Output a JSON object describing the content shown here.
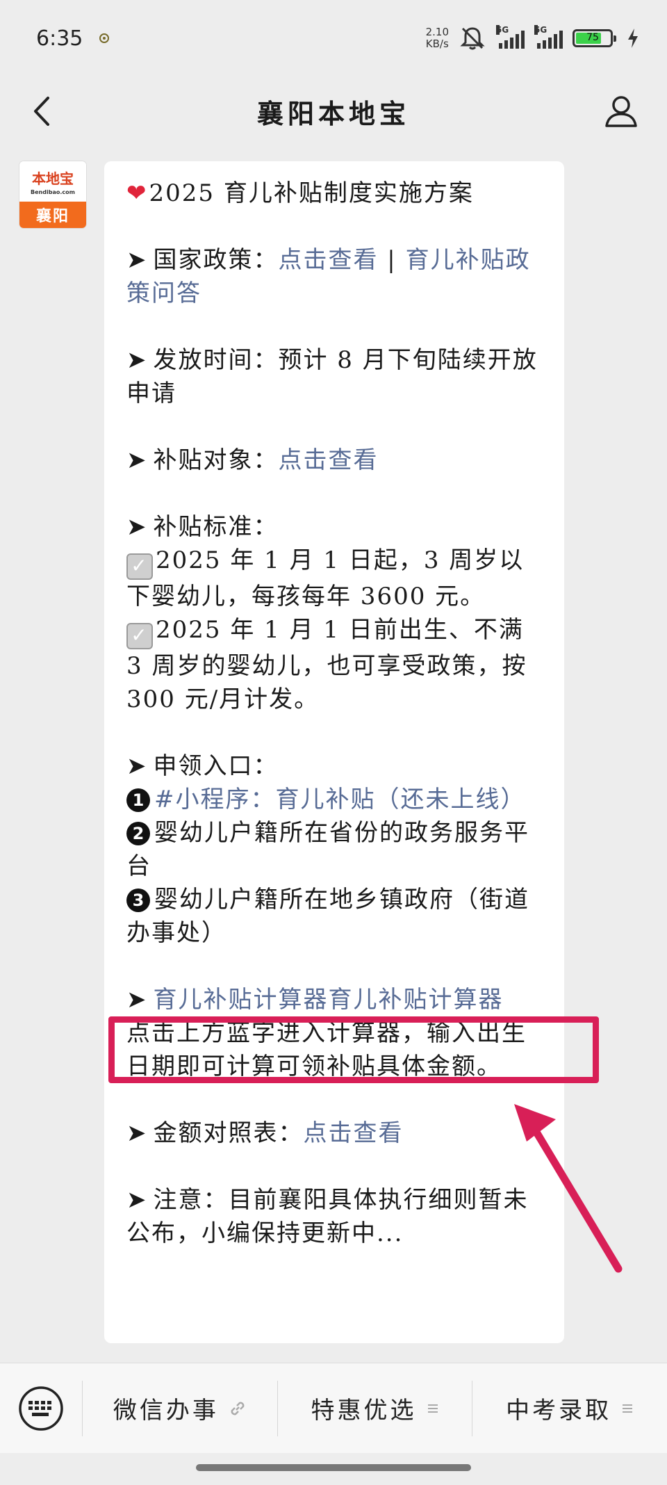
{
  "status_bar": {
    "time": "6:35",
    "net_speed_value": "2.10",
    "net_speed_unit": "KB/s",
    "sim1": "5G",
    "sim2": "5G",
    "battery": "75"
  },
  "nav": {
    "title": "襄阳本地宝"
  },
  "avatar": {
    "brand": "本地宝",
    "domain": "Bendibao.com",
    "city": "襄阳"
  },
  "message": {
    "title": "2025 育儿补贴制度实施方案",
    "national_policy": {
      "label": "国家政策：",
      "link1": "点击查看",
      "sep": " | ",
      "link2": "育儿补贴政策问答"
    },
    "release_time": {
      "label": "发放时间：",
      "text": "预计 8 月下旬陆续开放申请"
    },
    "target": {
      "label": "补贴对象：",
      "link": "点击查看"
    },
    "standard": {
      "label": "补贴标准：",
      "item1": "2025 年 1 月 1 日起，3 周岁以下婴幼儿，每孩每年 3600 元。",
      "item2": "2025 年 1 月 1 日前出生、不满 3 周岁的婴幼儿，也可享受政策，按 300 元/月计发。"
    },
    "entry": {
      "label": "申领入口：",
      "num1": "1",
      "item1_link": "#小程序：育儿补贴（还未上线）",
      "num2": "2",
      "item2": "婴幼儿户籍所在省份的政务服务平台",
      "num3": "3",
      "item3": "婴幼儿户籍所在地乡镇政府（街道办事处）"
    },
    "calculator": {
      "link": "育儿补贴计算器育儿补贴计算器",
      "desc": "点击上方蓝字进入计算器，输入出生日期即可计算可领补贴具体金额。"
    },
    "amount_table": {
      "label": "金额对照表：",
      "link": "点击查看"
    },
    "notice": {
      "label": "注意：",
      "text": "目前襄阳具体执行细则暂未公布，小编保持更新中..."
    }
  },
  "bottom_menu": {
    "items": [
      {
        "label": "微信办事",
        "icon": "link-icon"
      },
      {
        "label": "特惠优选",
        "icon": "menu-lines-icon"
      },
      {
        "label": "中考录取",
        "icon": "menu-lines-icon"
      }
    ]
  },
  "colors": {
    "link": "#576b95",
    "annotation": "#d81f57",
    "battery_fill": "#3bd14a",
    "avatar_orange": "#f26b1d"
  }
}
